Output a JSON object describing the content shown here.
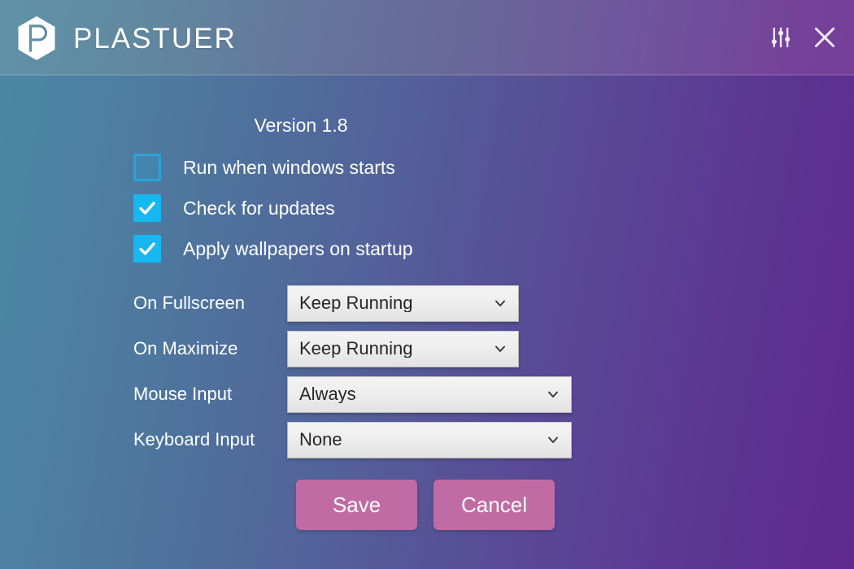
{
  "window": {
    "brand_name": "PLASTUER",
    "logo_letter": "P"
  },
  "titlebar": {
    "settings_icon": "sliders-icon",
    "close_icon": "close-icon",
    "settings_label": "Settings",
    "close_label": "Close"
  },
  "main": {
    "version_text": "Version 1.8",
    "checkboxes": [
      {
        "label": "Run when windows starts",
        "checked": false
      },
      {
        "label": "Check for updates",
        "checked": true
      },
      {
        "label": "Apply wallpapers on startup",
        "checked": true
      }
    ],
    "selects": [
      {
        "label": "On Fullscreen",
        "value": "Keep Running",
        "width": "narrow"
      },
      {
        "label": "On Maximize",
        "value": "Keep Running",
        "width": "narrow"
      },
      {
        "label": "Mouse Input",
        "value": "Always",
        "width": "wide"
      },
      {
        "label": "Keyboard Input",
        "value": "None",
        "width": "wide"
      }
    ],
    "buttons": {
      "save_label": "Save",
      "cancel_label": "Cancel"
    }
  },
  "colors": {
    "gradient_start": "#4b87a5",
    "gradient_end": "#5e2a90",
    "titlebar_start": "#5f92a8",
    "titlebar_end": "#753e97",
    "checkbox_accent": "#17b7f0",
    "checkbox_off_border": "#2aa3d8",
    "button_pink": "#c06ba3",
    "select_face": "#eeeeee",
    "text_light": "#ffffff",
    "text_dark": "#262626"
  }
}
